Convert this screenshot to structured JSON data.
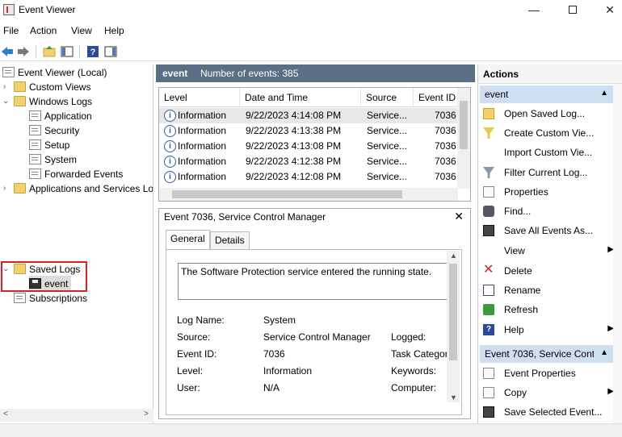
{
  "window": {
    "title": "Event Viewer",
    "minimize_glyph": "—",
    "close_glyph": "✕"
  },
  "menu": [
    "File",
    "Action",
    "View",
    "Help"
  ],
  "tree": {
    "root": "Event Viewer (Local)",
    "custom_views": "Custom Views",
    "windows_logs": "Windows Logs",
    "windows_logs_children": [
      "Application",
      "Security",
      "Setup",
      "System",
      "Forwarded Events"
    ],
    "apps_services": "Applications and Services Lo",
    "saved_logs": "Saved Logs",
    "saved_event": "event",
    "subscriptions": "Subscriptions"
  },
  "center": {
    "log_name": "event",
    "count_text": "Number of events: 385"
  },
  "grid": {
    "columns": [
      "Level",
      "Date and Time",
      "Source",
      "Event ID"
    ],
    "rows": [
      {
        "level": "Information",
        "date": "9/22/2023 4:14:08 PM",
        "source": "Service...",
        "id": "7036"
      },
      {
        "level": "Information",
        "date": "9/22/2023 4:13:38 PM",
        "source": "Service...",
        "id": "7036"
      },
      {
        "level": "Information",
        "date": "9/22/2023 4:13:08 PM",
        "source": "Service...",
        "id": "7036"
      },
      {
        "level": "Information",
        "date": "9/22/2023 4:12:38 PM",
        "source": "Service...",
        "id": "7036"
      },
      {
        "level": "Information",
        "date": "9/22/2023 4:12:08 PM",
        "source": "Service...",
        "id": "7036"
      }
    ]
  },
  "detail": {
    "title": "Event 7036, Service Control Manager",
    "tabs": [
      "General",
      "Details"
    ],
    "message": "The Software Protection service entered the running state.",
    "fields": {
      "log_name_label": "Log Name:",
      "log_name_value": "System",
      "source_label": "Source:",
      "source_value": "Service Control Manager",
      "logged_label": "Logged:",
      "event_id_label": "Event ID:",
      "event_id_value": "7036",
      "task_label": "Task Category",
      "level_label": "Level:",
      "level_value": "Information",
      "keywords_label": "Keywords:",
      "user_label": "User:",
      "user_value": "N/A",
      "computer_label": "Computer:"
    }
  },
  "actions": {
    "title": "Actions",
    "group1": "event",
    "group1_items": [
      "Open Saved Log...",
      "Create Custom Vie...",
      "Import Custom Vie...",
      "Filter Current Log...",
      "Properties",
      "Find...",
      "Save All Events As...",
      "View",
      "Delete",
      "Rename",
      "Refresh",
      "Help"
    ],
    "group2": "Event 7036, Service Cont...",
    "group2_items": [
      "Event Properties",
      "Copy",
      "Save Selected Event..."
    ]
  }
}
